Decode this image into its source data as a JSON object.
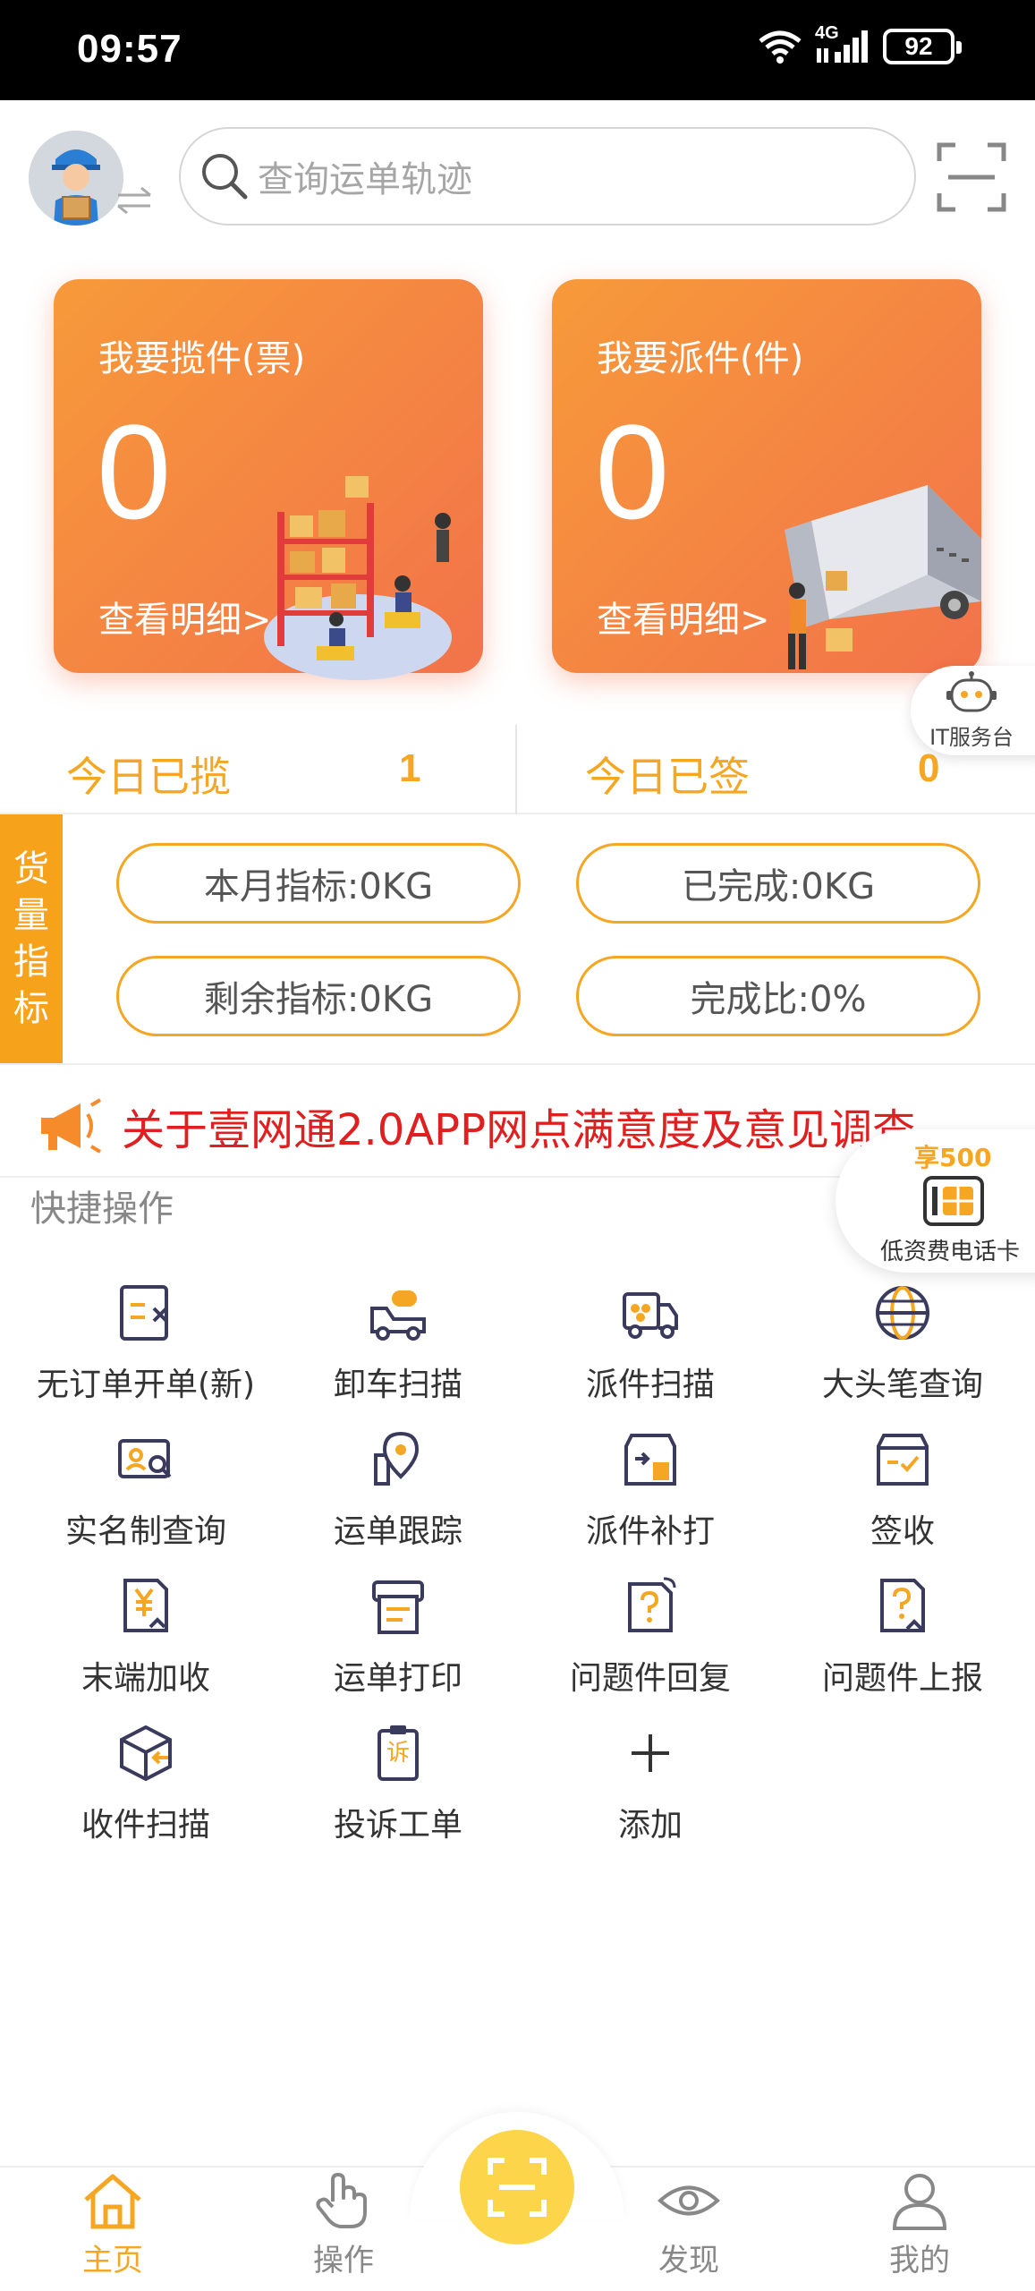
{
  "status_bar": {
    "time": "09:57",
    "network": "4G",
    "battery": "92"
  },
  "header": {
    "search_placeholder": "查询运单轨迹"
  },
  "cards": [
    {
      "title": "我要揽件(票)",
      "count": "0",
      "link": "查看明细>"
    },
    {
      "title": "我要派件(件)",
      "count": "0",
      "link": "查看明细>"
    }
  ],
  "it_service": {
    "label": "IT服务台"
  },
  "today": {
    "collected_label": "今日已揽",
    "collected_value": "1",
    "signed_label": "今日已签",
    "signed_value": "0"
  },
  "cargo": {
    "tab_chars": [
      "货",
      "量",
      "指",
      "标"
    ],
    "pills": [
      "本月指标:0KG",
      "已完成:0KG",
      "剩余指标:0KG",
      "完成比:0%"
    ]
  },
  "announcement": {
    "text": "关于壹网通2.0APP网点满意度及意见调查"
  },
  "phone_card": {
    "promo": "享500",
    "label": "低资费电话卡"
  },
  "quick_actions": {
    "title": "快捷操作",
    "items": [
      {
        "label": "无订单开单(新)",
        "icon": "no-order-icon"
      },
      {
        "label": "卸车扫描",
        "icon": "unload-truck-icon"
      },
      {
        "label": "派件扫描",
        "icon": "delivery-truck-icon"
      },
      {
        "label": "大头笔查询",
        "icon": "globe-icon"
      },
      {
        "label": "实名制查询",
        "icon": "id-card-search-icon"
      },
      {
        "label": "运单跟踪",
        "icon": "location-pin-icon"
      },
      {
        "label": "派件补打",
        "icon": "reprint-box-icon"
      },
      {
        "label": "签收",
        "icon": "sign-box-icon"
      },
      {
        "label": "末端加收",
        "icon": "yuan-doc-icon"
      },
      {
        "label": "运单打印",
        "icon": "printer-icon"
      },
      {
        "label": "问题件回复",
        "icon": "question-reply-icon"
      },
      {
        "label": "问题件上报",
        "icon": "question-upload-icon"
      },
      {
        "label": "收件扫描",
        "icon": "package-in-icon"
      },
      {
        "label": "投诉工单",
        "icon": "complaint-clipboard-icon"
      },
      {
        "label": "添加",
        "icon": "plus-icon"
      }
    ],
    "complaint_char": "诉"
  },
  "bottom_nav": {
    "items": [
      {
        "label": "主页",
        "active": true
      },
      {
        "label": "操作",
        "active": false
      },
      {
        "label": "发现",
        "active": false
      },
      {
        "label": "我的",
        "active": false
      }
    ]
  },
  "colors": {
    "accent": "#f5a623",
    "card_start": "#f79a3a",
    "card_end": "#f2734a",
    "announce": "#e02020",
    "icon_dark": "#3a3a5c"
  }
}
